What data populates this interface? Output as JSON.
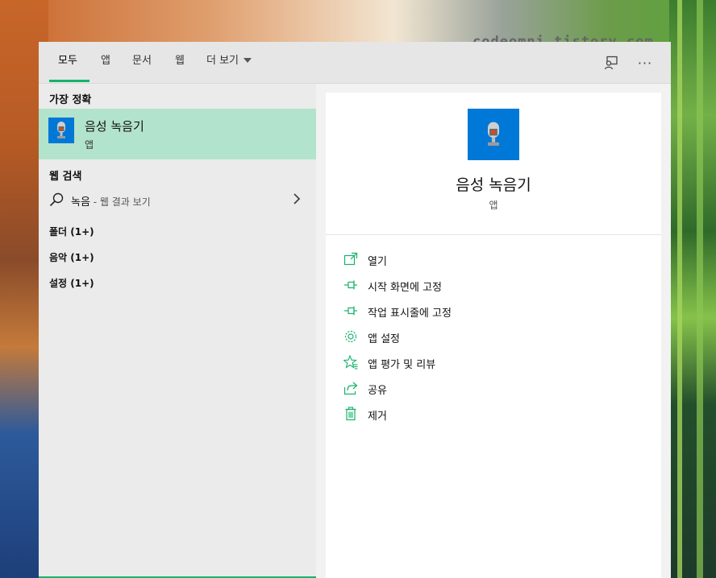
{
  "watermark": "codeomni.tistory.com",
  "tabs": [
    {
      "label": "모두",
      "active": true
    },
    {
      "label": "앱"
    },
    {
      "label": "문서"
    },
    {
      "label": "웹"
    },
    {
      "label": "더 보기"
    }
  ],
  "topbar_icons": [
    "feedback-icon",
    "more-options-icon"
  ],
  "more_glyph": "···",
  "left": {
    "best_match_title": "가장 정확",
    "best_match": {
      "name": "음성 녹음기",
      "type": "앱",
      "icon": "microphone-icon"
    },
    "web_search_title": "웹 검색",
    "web_search": {
      "term": "녹음",
      "suffix": " - 웹 결과 보기"
    },
    "categories": [
      "폴더 (1+)",
      "음악 (1+)",
      "설정 (1+)"
    ]
  },
  "detail": {
    "name": "음성 녹음기",
    "type": "앱",
    "icon": "microphone-icon",
    "actions": [
      {
        "label": "열기",
        "icon": "open-icon"
      },
      {
        "label": "시작 화면에 고정",
        "icon": "pin-icon"
      },
      {
        "label": "작업 표시줄에 고정",
        "icon": "pin-icon"
      },
      {
        "label": "앱 설정",
        "icon": "gear-icon"
      },
      {
        "label": "앱 평가 및 리뷰",
        "icon": "star-icon"
      },
      {
        "label": "공유",
        "icon": "share-icon"
      },
      {
        "label": "제거",
        "icon": "trash-icon"
      }
    ]
  },
  "colors": {
    "accent": "#17b26b",
    "tile": "#0078d7",
    "highlight": "#b2e3cc"
  }
}
